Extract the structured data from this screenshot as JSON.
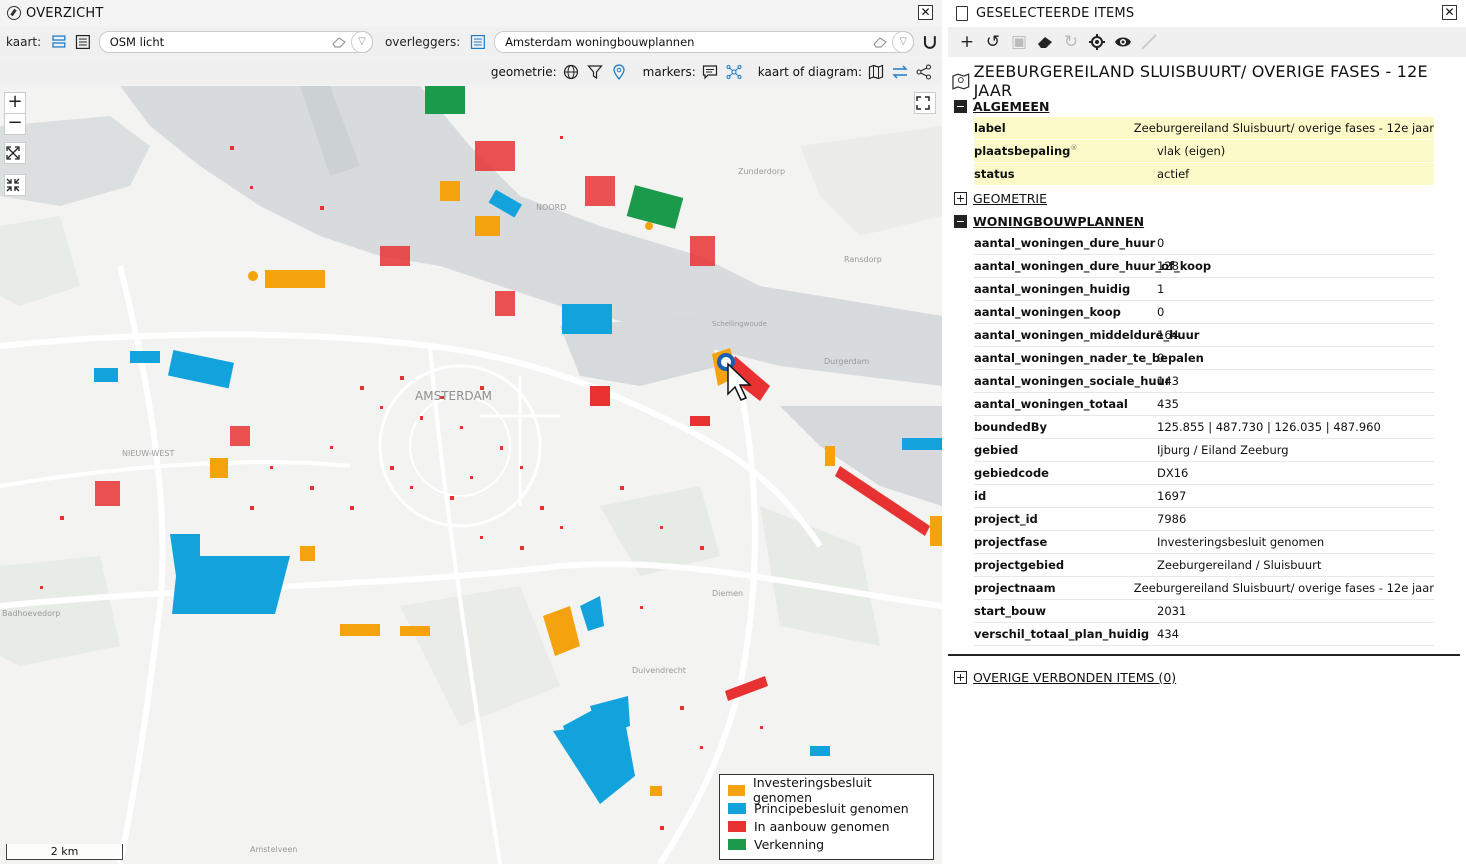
{
  "left_panel": {
    "title": "OVERZICHT",
    "kaart_label": "kaart:",
    "kaart_value": "OSM licht",
    "overleggers_label": "overleggers:",
    "overleggers_value": "Amsterdam woningbouwplannen",
    "geometrie_label": "geometrie:",
    "markers_label": "markers:",
    "kaart_of_diagram_label": "kaart of diagram:",
    "map": {
      "city_label": "AMSTERDAM",
      "place_labels": [
        "Zunderdorp",
        "NOORD",
        "Ransdorp",
        "Schellingwoude",
        "Durgerdam",
        "NIEUW-WEST",
        "Badhoevedorp",
        "Diemen",
        "Duivendrecht",
        "Amstelveen"
      ],
      "scale_label": "2 km",
      "zoom_in": "+",
      "zoom_out": "−"
    },
    "legend": [
      {
        "label": "Investeringsbesluit genomen",
        "color": "#f5a20f"
      },
      {
        "label": "Principebesluit genomen",
        "color": "#12a3dd"
      },
      {
        "label": "In aanbouw genomen",
        "color": "#e83232"
      },
      {
        "label": "Verkenning",
        "color": "#1a9a4a"
      }
    ]
  },
  "right_panel": {
    "title": "GESELECTEERDE ITEMS",
    "heading": "ZEEBURGEREILAND SLUISBUURT/ OVERIGE FASES - 12E JAAR",
    "sections": {
      "algemeen": "ALGEMEEN",
      "geometrie": "GEOMETRIE",
      "woningbouwplannen": "WONINGBOUWPLANNEN",
      "overige": "OVERIGE VERBONDEN ITEMS (0)"
    },
    "algemeen_rows": [
      {
        "key": "label",
        "value": "Zeeburgereiland Sluisbuurt/ overige fases -  12e jaar"
      },
      {
        "key": "plaatsbepaling",
        "value": "vlak (eigen)"
      },
      {
        "key": "status",
        "value": "actief"
      }
    ],
    "plaatsbepaling_sup": "®",
    "woningbouw_rows": [
      {
        "key": "aantal_woningen_dure_huur",
        "value": "0"
      },
      {
        "key": "aantal_woningen_dure_huur_of_koop",
        "value": "128"
      },
      {
        "key": "aantal_woningen_huidig",
        "value": "1"
      },
      {
        "key": "aantal_woningen_koop",
        "value": "0"
      },
      {
        "key": "aantal_woningen_middeldure_huur",
        "value": "164"
      },
      {
        "key": "aantal_woningen_nader_te_bepalen",
        "value": "0"
      },
      {
        "key": "aantal_woningen_sociale_huur",
        "value": "143"
      },
      {
        "key": "aantal_woningen_totaal",
        "value": "435"
      },
      {
        "key": "boundedBy",
        "value": "125.855 | 487.730 | 126.035 | 487.960"
      },
      {
        "key": "gebied",
        "value": "Ijburg / Eiland Zeeburg"
      },
      {
        "key": "gebiedcode",
        "value": "DX16"
      },
      {
        "key": "id",
        "value": "1697"
      },
      {
        "key": "project_id",
        "value": "7986"
      },
      {
        "key": "projectfase",
        "value": "Investeringsbesluit genomen"
      },
      {
        "key": "projectgebied",
        "value": "Zeeburgereiland / Sluisbuurt"
      },
      {
        "key": "projectnaam",
        "value": "Zeeburgereiland Sluisbuurt/ overige fases -  12e jaar"
      },
      {
        "key": "start_bouw",
        "value": "2031"
      },
      {
        "key": "verschil_totaal_plan_huidig",
        "value": "434"
      }
    ]
  }
}
